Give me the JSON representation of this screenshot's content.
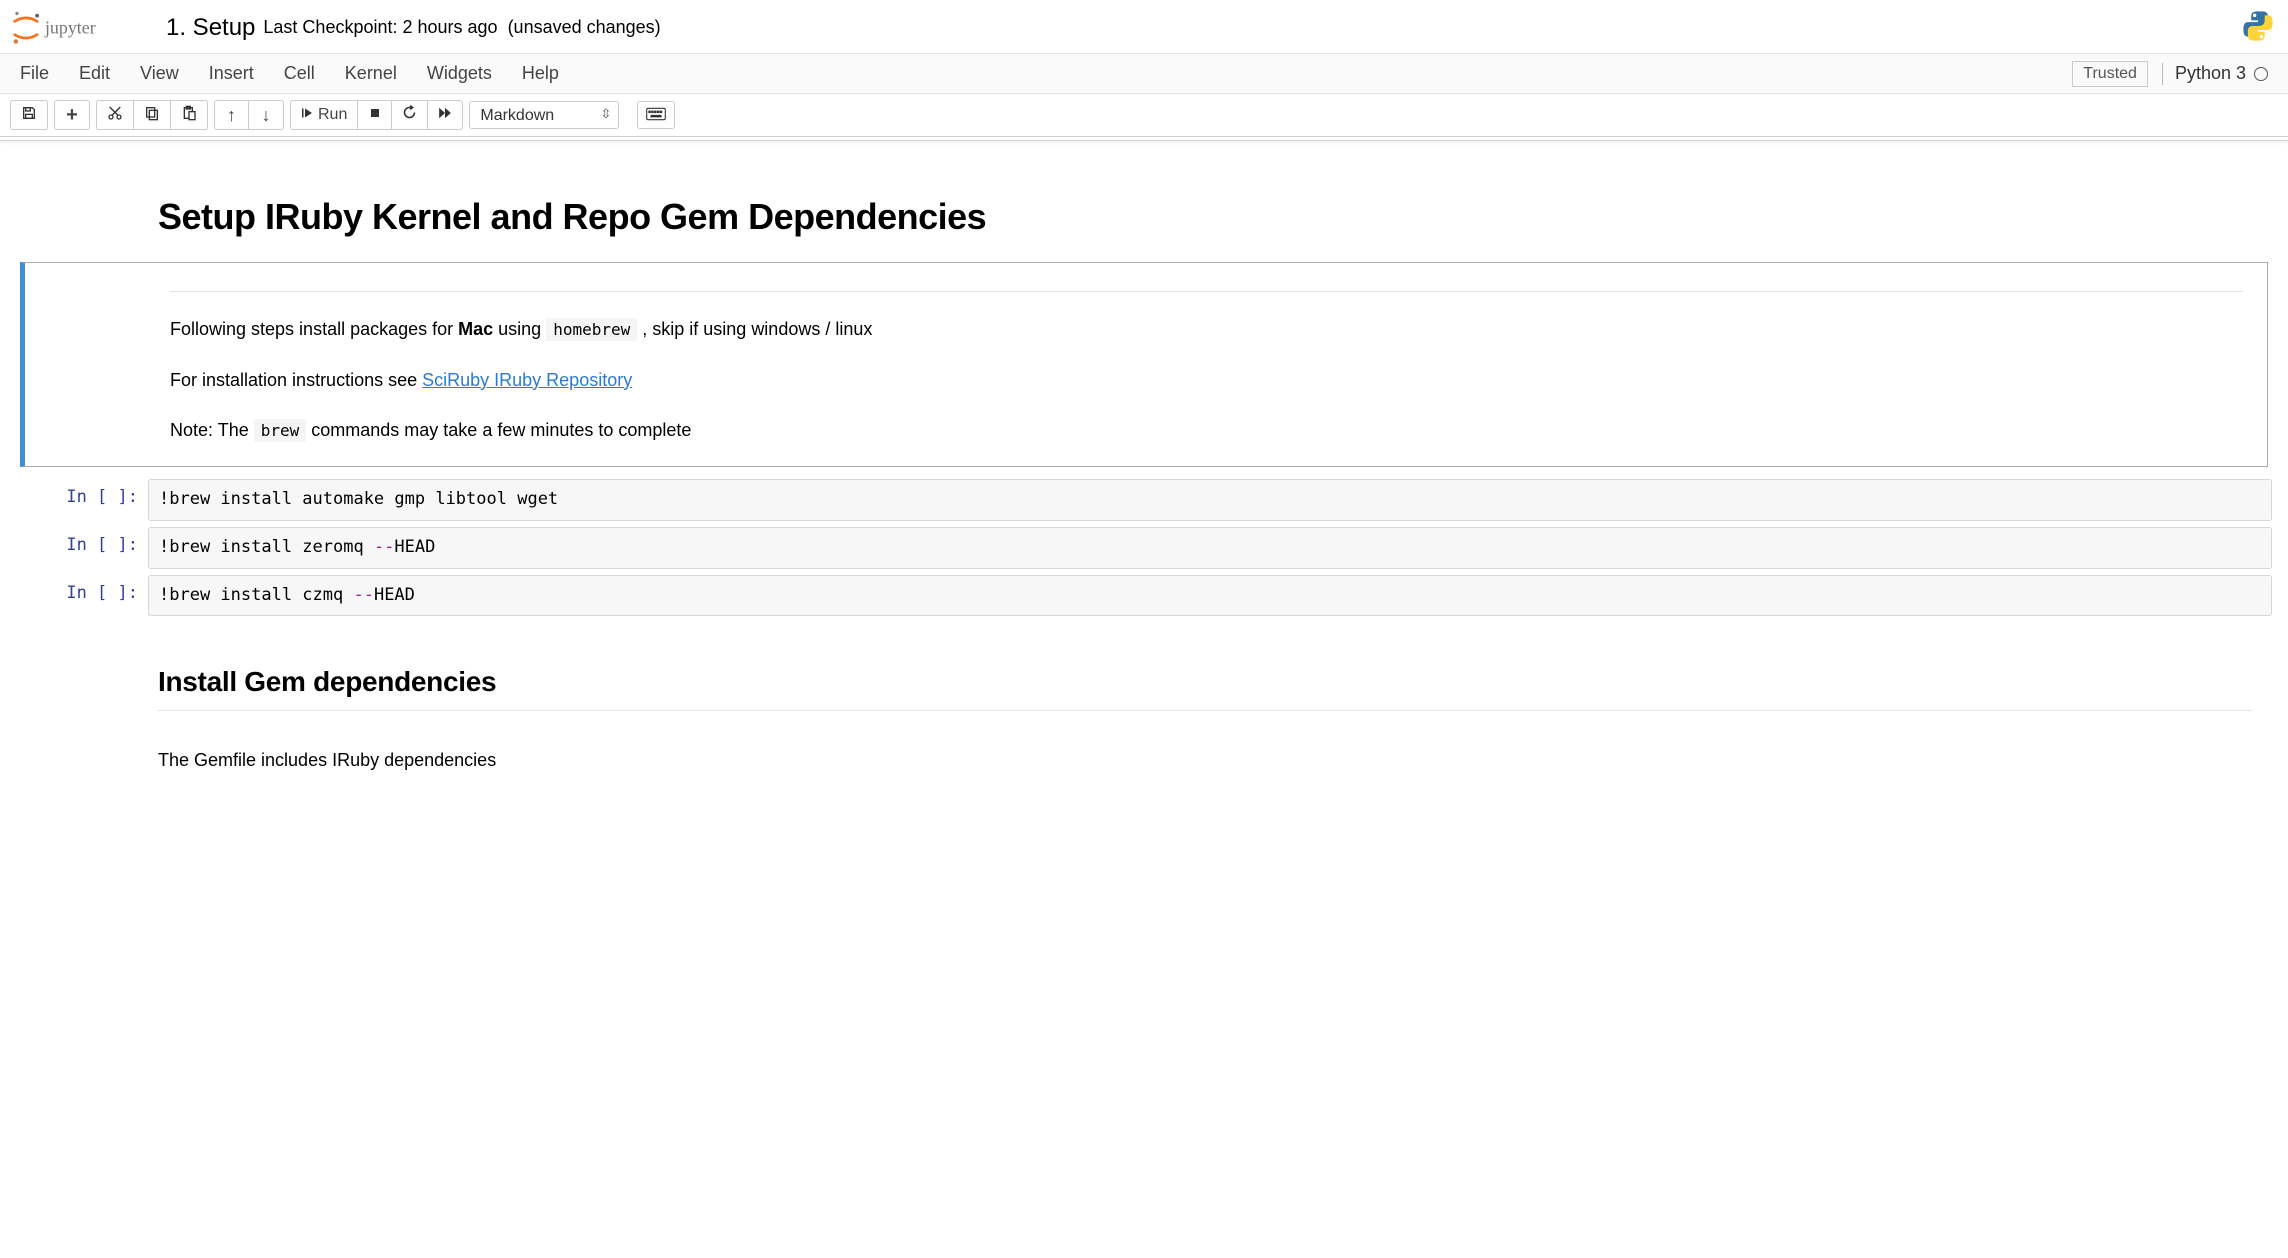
{
  "header": {
    "notebook_name": "1. Setup",
    "checkpoint": "Last Checkpoint: 2 hours ago",
    "unsaved": "(unsaved changes)"
  },
  "menubar": {
    "items": [
      "File",
      "Edit",
      "View",
      "Insert",
      "Cell",
      "Kernel",
      "Widgets",
      "Help"
    ],
    "trusted": "Trusted",
    "kernel_name": "Python 3"
  },
  "toolbar": {
    "run_label": "Run",
    "cell_type": "Markdown"
  },
  "cells": {
    "md0": {
      "h1": "Setup IRuby Kernel and Repo Gem Dependencies"
    },
    "md1": {
      "p1_pre": "Following steps install packages for ",
      "p1_bold": "Mac",
      "p1_mid": " using ",
      "p1_code": "homebrew",
      "p1_post": " , skip if using windows / linux",
      "p2_pre": "For installation instructions see ",
      "p2_link": "SciRuby IRuby Repository",
      "p3_pre": "Note: The ",
      "p3_code": "brew",
      "p3_post": " commands may take a few minutes to complete"
    },
    "code0": {
      "prompt": "In [ ]:",
      "text": "!brew install automake gmp libtool wget"
    },
    "code1": {
      "prompt": "In [ ]:",
      "bang": "!brew install zeromq ",
      "flag": "--",
      "rest": "HEAD"
    },
    "code2": {
      "prompt": "In [ ]:",
      "bang": "!brew install czmq ",
      "flag": "--",
      "rest": "HEAD"
    },
    "md2": {
      "h2": "Install Gem dependencies",
      "p": "The Gemfile includes IRuby dependencies"
    }
  }
}
